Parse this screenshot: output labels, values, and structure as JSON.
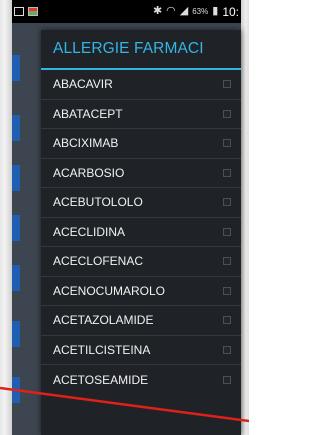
{
  "status_bar": {
    "battery_level": "63%",
    "time": "10:"
  },
  "dialog": {
    "title": "ALLERGIE FARMACI",
    "items": [
      {
        "label": "ABACAVIR",
        "checked": false
      },
      {
        "label": "ABATACEPT",
        "checked": false
      },
      {
        "label": "ABCIXIMAB",
        "checked": false
      },
      {
        "label": "ACARBOSIO",
        "checked": false
      },
      {
        "label": "ACEBUTOLOLO",
        "checked": false
      },
      {
        "label": "ACECLIDINA",
        "checked": false
      },
      {
        "label": "ACECLOFENAC",
        "checked": false
      },
      {
        "label": "ACENOCUMAROLO",
        "checked": false
      },
      {
        "label": "ACETAZOLAMIDE",
        "checked": false
      },
      {
        "label": "ACETILCISTEINA",
        "checked": false
      },
      {
        "label": "ACETOSEAMIDE",
        "checked": false
      }
    ]
  },
  "colors": {
    "accent": "#33b5e5",
    "dialog_bg": "#1f2327",
    "annotation": "#e0201a"
  }
}
